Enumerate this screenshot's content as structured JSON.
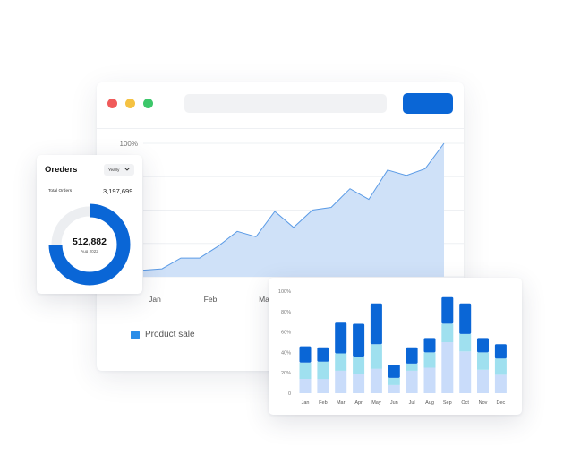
{
  "browser": {
    "controls": [
      "close",
      "minimize",
      "maximize"
    ],
    "action_button_label": "",
    "legend_label": "Product sale"
  },
  "orders": {
    "title": "Oreders",
    "period": "Yearly",
    "total_label": "Total Orders",
    "total_value": "3,197,699",
    "center_value": "512,882",
    "center_sub": "Aug 2022"
  },
  "colors": {
    "accent": "#0a66d6",
    "area_fill": "#cfe1f8",
    "area_line": "#5b9be6",
    "bar_top": "#0a66d6",
    "bar_mid": "#9fe0ef",
    "bar_bottom": "#c9dcfa"
  },
  "chart_data": [
    {
      "type": "area",
      "title": "",
      "x_ticks_visible": [
        "Jan",
        "Feb",
        "Ma"
      ],
      "y_ticks_visible": [
        "100%"
      ],
      "series": [
        {
          "name": "Product sale",
          "values": [
            5,
            6,
            14,
            14,
            23,
            34,
            30,
            49,
            37,
            50,
            52,
            66,
            58,
            80,
            76,
            81,
            100
          ]
        }
      ],
      "ylim": [
        0,
        100
      ]
    },
    {
      "type": "bar",
      "title": "",
      "stacked": true,
      "categories": [
        "Jan",
        "Feb",
        "Mar",
        "Apr",
        "May",
        "Jun",
        "Jul",
        "Aug",
        "Sep",
        "Oct",
        "Nov",
        "Dec"
      ],
      "y_ticks": [
        "0",
        "20%",
        "40%",
        "60%",
        "80%",
        "100%"
      ],
      "ylim": [
        0,
        100
      ],
      "series": [
        {
          "values": [
            14,
            14,
            22,
            19,
            24,
            8,
            22,
            25,
            50,
            41,
            23,
            18
          ]
        },
        {
          "values": [
            16,
            17,
            17,
            17,
            24,
            7,
            7,
            15,
            18,
            17,
            17,
            16
          ]
        },
        {
          "values": [
            16,
            14,
            30,
            32,
            40,
            13,
            16,
            14,
            26,
            30,
            14,
            14
          ]
        }
      ]
    },
    {
      "type": "pie",
      "title": "",
      "donut": true,
      "values": [
        75,
        25
      ]
    }
  ]
}
